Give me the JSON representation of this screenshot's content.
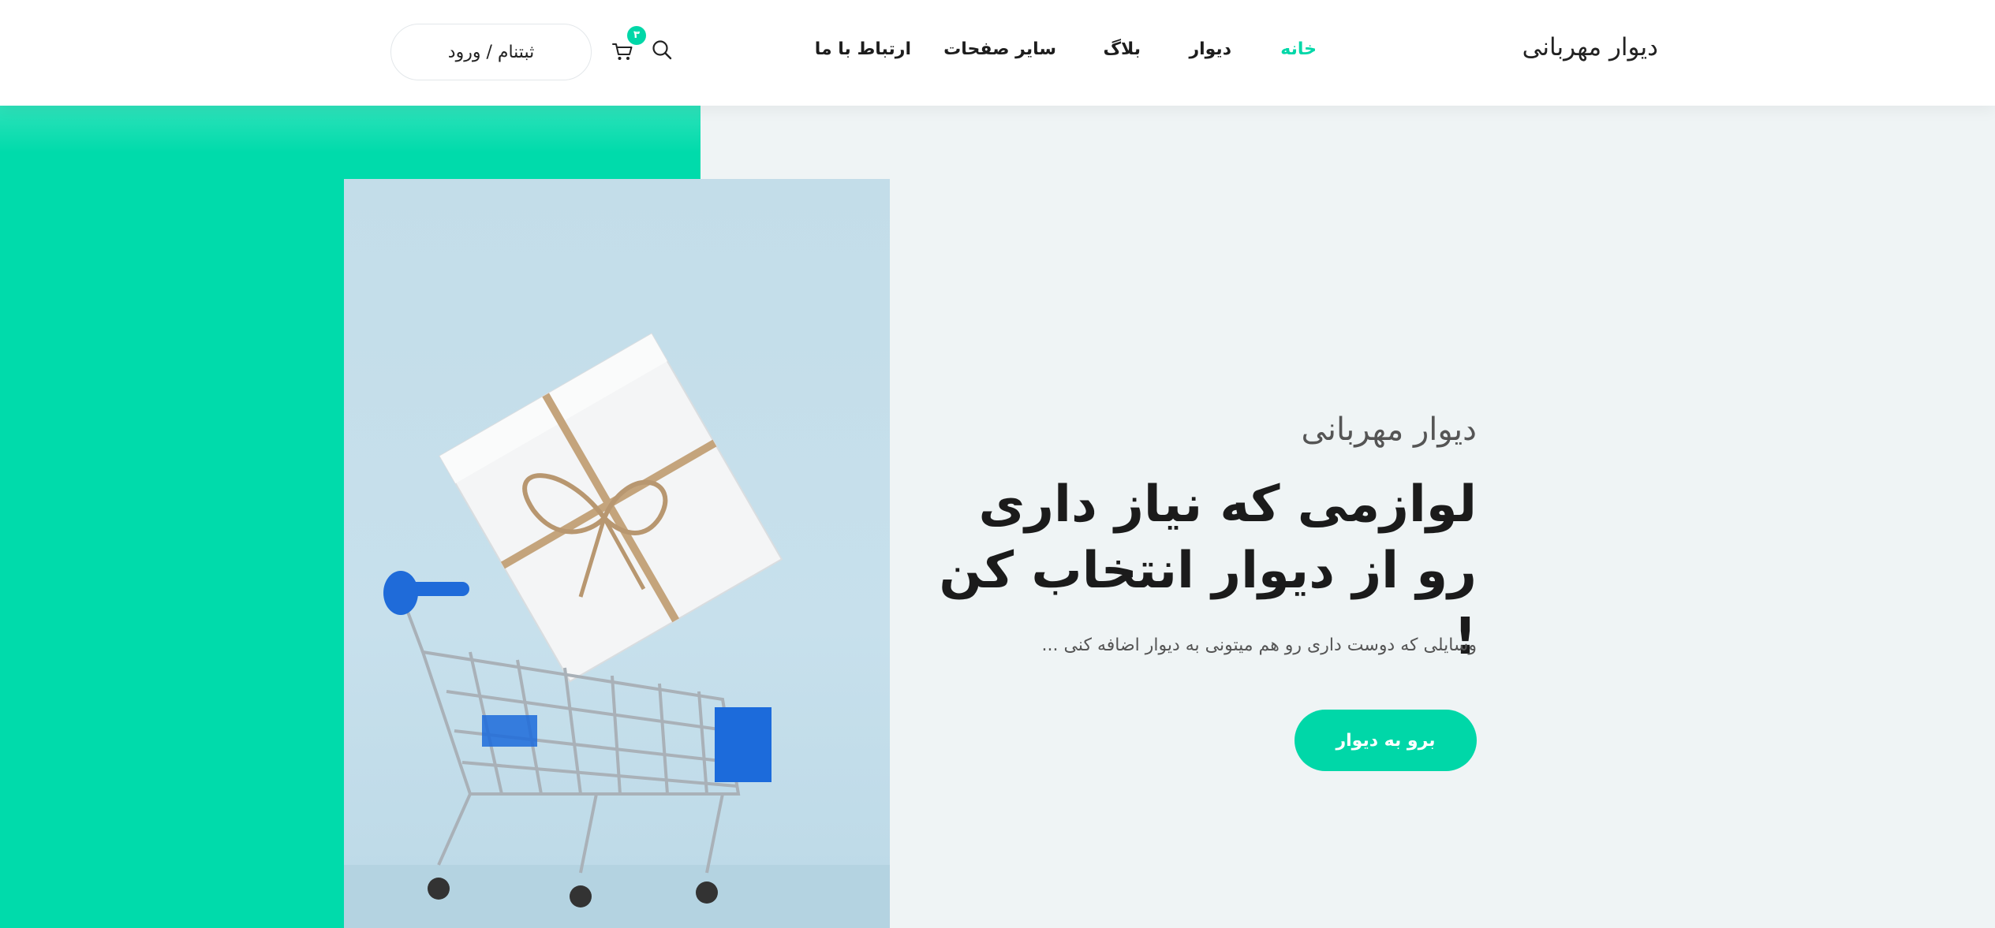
{
  "header": {
    "brand": "دیوار مهربانی",
    "nav": [
      {
        "label": "خانه",
        "active": true
      },
      {
        "label": "دیوار",
        "active": false
      },
      {
        "label": "بلاگ",
        "active": false
      },
      {
        "label": "سایر صفحات",
        "active": false
      },
      {
        "label": "ارتباط با ما",
        "active": false
      }
    ],
    "cart_count": "۳",
    "login_label": "ثبتنام / ورود",
    "search_icon": "search-icon",
    "cart_icon": "cart-icon"
  },
  "hero": {
    "subtitle": "دیوار مهربانی",
    "title": "لوازمی که نیاز داری رو از دیوار انتخاب کن !",
    "description": "وسایلی که دوست داری رو هم میتونی به دیوار اضافه کنی ...",
    "button_label": "برو به دیوار"
  },
  "colors": {
    "accent": "#00d7a8",
    "hero_background": "#eff4f5",
    "green_block": "#00dbab"
  }
}
